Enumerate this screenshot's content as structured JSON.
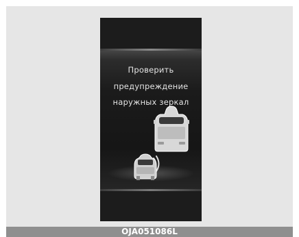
{
  "display": {
    "message_lines": [
      "Проверить",
      "предупреждение",
      "наружных зеркал"
    ]
  },
  "icons": {
    "host_car": "car-rear-icon",
    "approaching_car": "car-front-icon",
    "signal": "sensor-waves-icon"
  },
  "caption": "OJA051086L",
  "colors": {
    "screen": "#1c1c1c",
    "text": "#e4e4e4",
    "caption_bar": "#8f8f8f",
    "background": "#e6e6e6"
  }
}
